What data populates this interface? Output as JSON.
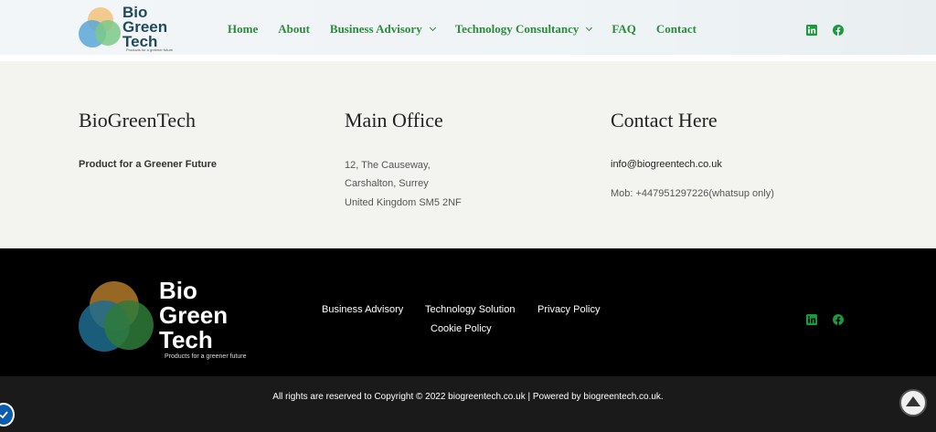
{
  "header": {
    "logo": {
      "line1": "Bio",
      "line2": "Green",
      "line3": "Tech",
      "tagline": "Products for a greener future"
    },
    "nav": [
      {
        "label": "Home",
        "dropdown": false
      },
      {
        "label": "About",
        "dropdown": false
      },
      {
        "label": "Business Advisory",
        "dropdown": true
      },
      {
        "label": "Technology Consultancy",
        "dropdown": true
      },
      {
        "label": "FAQ",
        "dropdown": false
      },
      {
        "label": "Contact",
        "dropdown": false
      }
    ],
    "social_icons": [
      "linkedin-icon",
      "facebook-icon"
    ]
  },
  "info": {
    "brand_heading": "BioGreenTech",
    "brand_tagline": "Product for a Greener Future",
    "office_heading": "Main Office",
    "address": [
      "12, The Causeway,",
      "Carshalton, Surrey",
      "United Kingdom SM5 2NF"
    ],
    "contact_heading": "Contact Here",
    "email": "info@biogreentech.co.uk",
    "mobile": "Mob: +447951297226(whatsup only)"
  },
  "footer": {
    "logo": {
      "line1": "Bio",
      "line2": "Green",
      "line3": "Tech",
      "tagline": "Products for a greener future"
    },
    "links": [
      "Business Advisory",
      "Technology Solution",
      "Privacy Policy",
      "Cookie Policy"
    ],
    "social_icons": [
      "linkedin-icon",
      "facebook-icon"
    ],
    "copyright": "All rights are reserved to Copyright © 2022 biogreentech.co.uk | Powered by biogreentech.co.uk."
  },
  "colors": {
    "nav_green": "#2e8b3e",
    "social_green": "#1a9a3c",
    "footer_bg": "#000000",
    "info_bg": "#f3f4f0"
  }
}
